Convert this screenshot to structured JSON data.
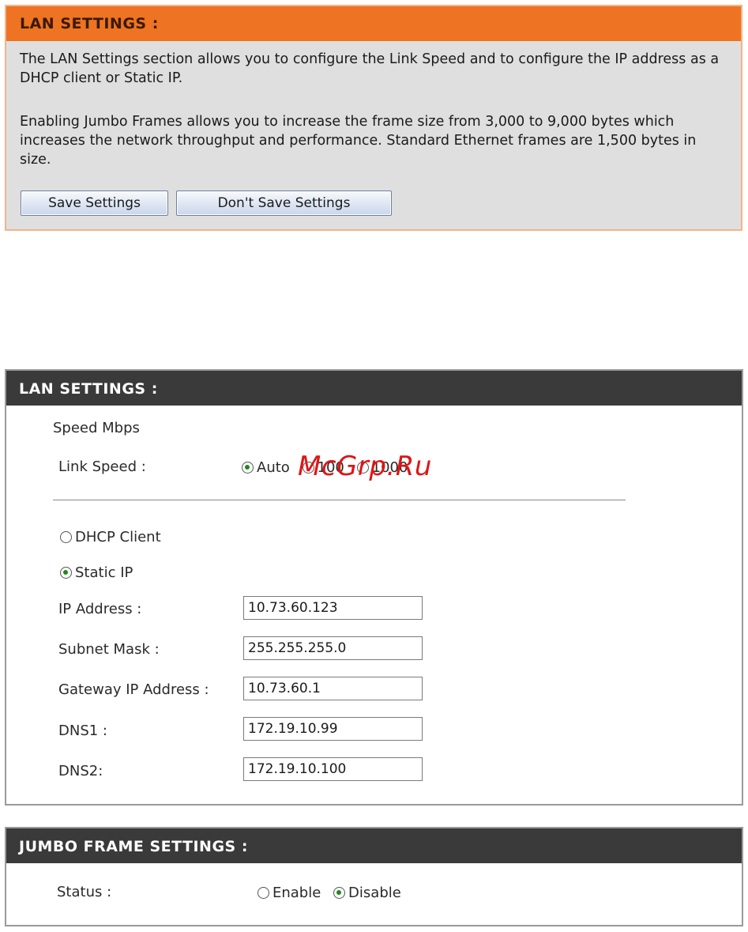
{
  "info_panel": {
    "title": "LAN SETTINGS :",
    "paragraph1": "The LAN Settings section allows you to configure the Link Speed and to configure the IP address as a DHCP client or Static IP.",
    "paragraph2": "Enabling Jumbo Frames allows you to increase the frame size from 3,000 to 9,000 bytes which increases the network throughput and performance. Standard Ethernet frames are 1,500 bytes in size.",
    "save_label": "Save Settings",
    "dont_save_label": "Don't Save Settings"
  },
  "lan_panel": {
    "title": "LAN SETTINGS :",
    "speed_heading": "Speed Mbps",
    "link_speed_label": "Link Speed :",
    "link_speed_options": [
      "Auto",
      "100",
      "1000"
    ],
    "link_speed_selected": "Auto",
    "dhcp_label": "DHCP Client",
    "static_label": "Static IP",
    "ip_mode_selected": "Static IP",
    "fields": {
      "ip_address": {
        "label": "IP Address :",
        "value": "10.73.60.123"
      },
      "subnet_mask": {
        "label": "Subnet Mask :",
        "value": "255.255.255.0"
      },
      "gateway": {
        "label": "Gateway IP Address :",
        "value": "10.73.60.1"
      },
      "dns1": {
        "label": "DNS1 :",
        "value": "172.19.10.99"
      },
      "dns2": {
        "label": "DNS2:",
        "value": "172.19.10.100"
      }
    }
  },
  "jumbo_panel": {
    "title": "JUMBO FRAME SETTINGS :",
    "status_label": "Status :",
    "enable_label": "Enable",
    "disable_label": "Disable",
    "status_selected": "Disable"
  },
  "watermark": "McGrp.Ru",
  "colors": {
    "orange_header": "#ee7322",
    "dark_header": "#3a3a3a",
    "watermark": "#e01515",
    "radio_dot": "#1c8a1c"
  }
}
